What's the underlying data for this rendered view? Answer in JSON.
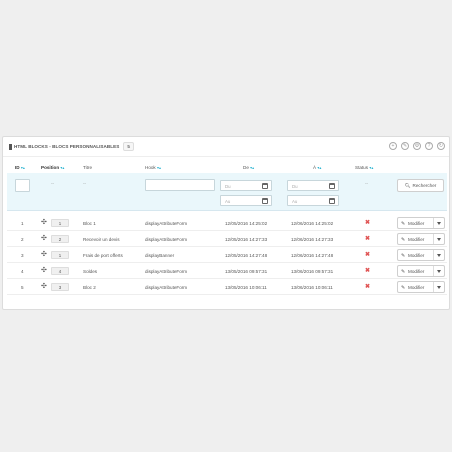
{
  "panel": {
    "title": "HTML BLOCKS - BLOCS PERSONNALISABLES",
    "count": "5",
    "tool_icons": [
      "add-icon",
      "edit-icon",
      "settings-icon",
      "help-icon",
      "refresh-icon"
    ]
  },
  "table": {
    "headers": {
      "id": "ID",
      "position": "Position",
      "titre": "Titre",
      "hook": "Hook",
      "de": "De",
      "a": "À",
      "status": "Status"
    },
    "filters": {
      "position_dash": "--",
      "titre_dash": "--",
      "status_dash": "--",
      "de_from_placeholder": "Du",
      "de_to_placeholder": "Au",
      "a_from_placeholder": "Du",
      "a_to_placeholder": "Au",
      "search_label": "Rechercher"
    },
    "rows": [
      {
        "id": "1",
        "position": "1",
        "titre": "Bloc 1",
        "hook": "displayAttributeForm",
        "de": "12/05/2016 14:25:02",
        "a": "12/06/2016 14:25:02",
        "status": "disabled"
      },
      {
        "id": "2",
        "position": "2",
        "titre": "Recevoir un devis",
        "hook": "displayAttributeForm",
        "de": "12/05/2016 14:27:33",
        "a": "12/06/2016 14:27:33",
        "status": "disabled"
      },
      {
        "id": "3",
        "position": "1",
        "titre": "Frais de port offerts",
        "hook": "displayBanner",
        "de": "12/05/2016 14:27:48",
        "a": "12/06/2016 14:27:48",
        "status": "disabled"
      },
      {
        "id": "4",
        "position": "4",
        "titre": "Soldes",
        "hook": "displayAttributeForm",
        "de": "13/05/2016 09:57:31",
        "a": "13/06/2016 09:57:31",
        "status": "disabled"
      },
      {
        "id": "5",
        "position": "3",
        "titre": "Bloc 2",
        "hook": "displayAttributeForm",
        "de": "13/05/2016 10:06:11",
        "a": "13/06/2016 10:06:11",
        "status": "disabled"
      }
    ],
    "row_action_label": "Modifier"
  }
}
